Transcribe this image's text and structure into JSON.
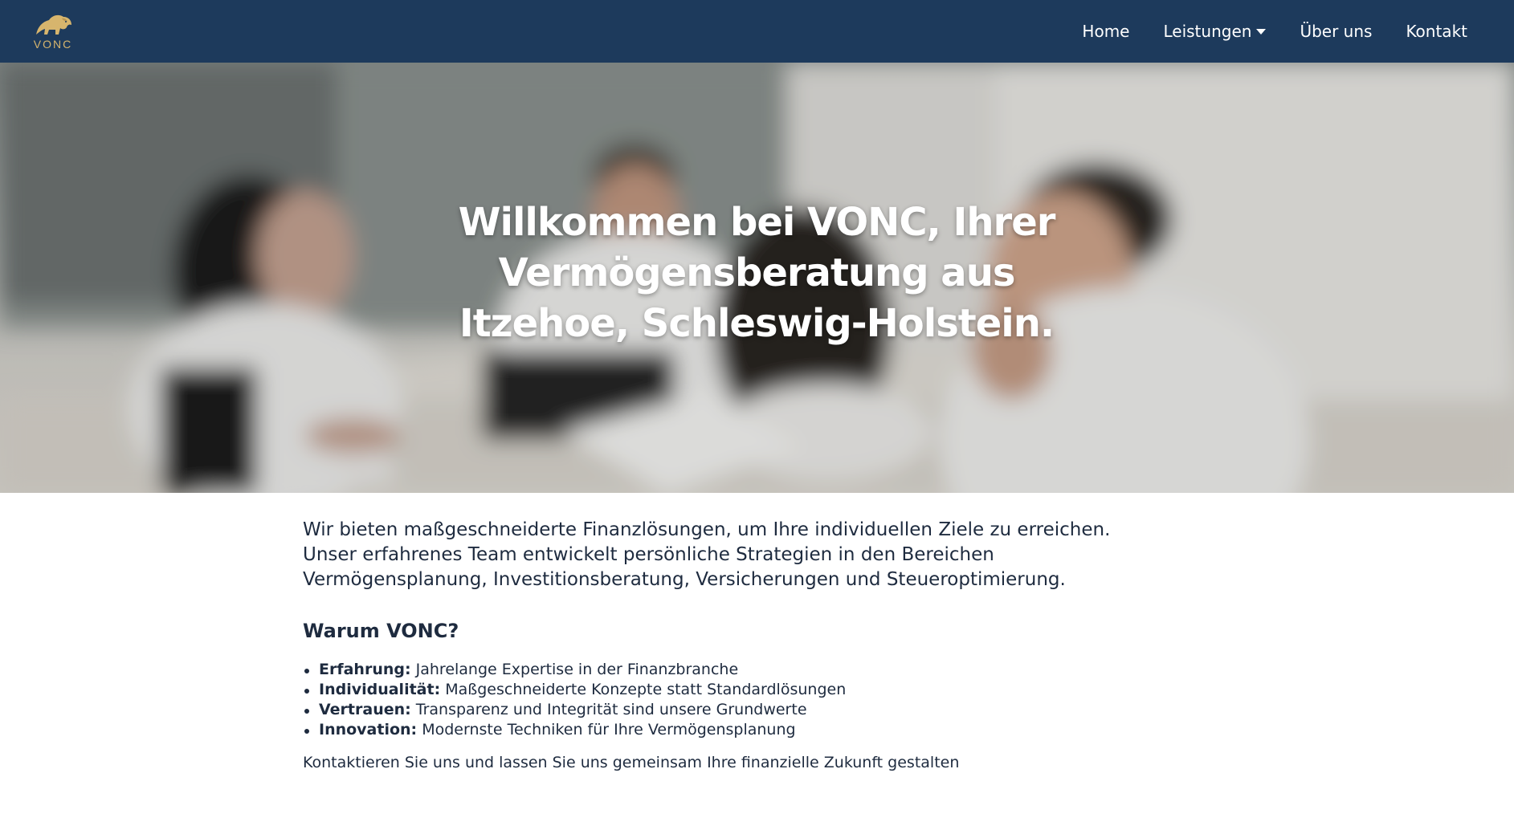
{
  "header": {
    "logo_text": "VONC",
    "logo_icon": "lion-icon",
    "background_color": "#1d3a5c",
    "accent_color": "#d7b56d",
    "nav": [
      {
        "label": "Home"
      },
      {
        "label": "Leistungen",
        "dropdown": true
      },
      {
        "label": "Über uns"
      },
      {
        "label": "Kontakt"
      }
    ]
  },
  "hero": {
    "title": "Willkommen bei VONC, Ihrer Vermögensberatung aus Itzehoe, Schleswig-Holstein."
  },
  "main": {
    "intro": "Wir bieten maßgeschneiderte Finanzlösungen, um Ihre individuellen Ziele zu erreichen. Unser erfahrenes Team entwickelt persönliche Strategien in den Bereichen Vermögensplanung, Investitionsberatung, Versicherungen und Steueroptimierung.",
    "why_title": "Warum VONC?",
    "benefits": [
      {
        "term": "Erfahrung:",
        "text": "Jahrelange Expertise in der Finanzbranche"
      },
      {
        "term": "Individualität:",
        "text": "Maßgeschneiderte Konzepte statt Standardlösungen"
      },
      {
        "term": "Vertrauen:",
        "text": "Transparenz und Integrität sind unsere Grundwerte"
      },
      {
        "term": "Innovation:",
        "text": "Modernste Techniken für Ihre Vermögensplanung"
      }
    ],
    "cta": "Kontaktieren Sie uns und lassen Sie uns gemeinsam Ihre finanzielle Zukunft gestalten"
  }
}
